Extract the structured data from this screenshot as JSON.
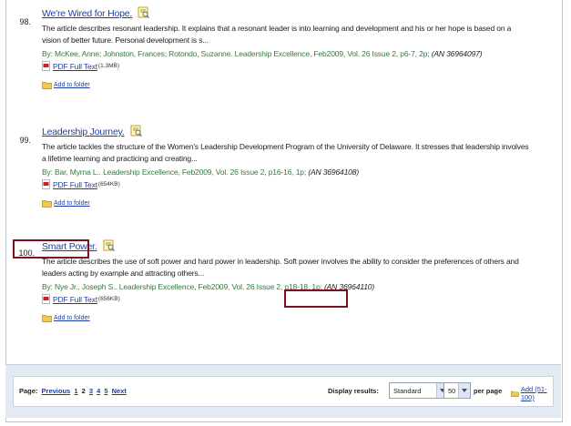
{
  "results": [
    {
      "number": "98.",
      "title": "We're Wired for Hope.",
      "abstract": "The article describes resonant leadership. It explains that a resonant leader is into learning and development and his or her hope is based on a vision of better future. Personal development is s...",
      "source": "By: McKee, Anne; Johnston, Frances; Rotondo, Suzanne. Leadership Excellence, Feb2009, Vol. 26 Issue 2, p6-7, 2p;",
      "an": "(AN 36964097)",
      "pdf_label": "PDF Full Text",
      "pdf_size": "(1.3MB)",
      "folder_label": "Add to folder"
    },
    {
      "number": "99.",
      "title": "Leadership Journey.",
      "abstract": "The article tackles the structure of the Women's Leadership Development Program of the University of Delaware. It stresses that leadership involves a lifetime learning and practicing and creating...",
      "source": "By: Bar, Myrna L.. Leadership Excellence, Feb2009, Vol. 26 Issue 2, p16-16, 1p;",
      "an": "(AN 36964108)",
      "pdf_label": "PDF Full Text",
      "pdf_size": "(654KB)",
      "folder_label": "Add to folder"
    },
    {
      "number": "100.",
      "title": "Smart Power.",
      "abstract": "The article describes the use of soft power and hard power in leadership. Soft power involves the ability to consider the preferences of others and leaders acting by example and attracting others...",
      "source": "By: Nye Jr., Joseph S.. Leadership Excellence, Feb2009, Vol. 26 Issue 2, p18-18, 1p;",
      "an": "(AN 36964110)",
      "pdf_label": "PDF Full Text",
      "pdf_size": "(656KB)",
      "folder_label": "Add to folder"
    }
  ],
  "pagination": {
    "label": "Page:",
    "previous": "Previous",
    "pages": [
      "1",
      "2",
      "3",
      "4",
      "5"
    ],
    "current": "2",
    "next": "Next"
  },
  "display": {
    "label": "Display results:",
    "mode": "Standard",
    "count": "50",
    "per_page": "per page",
    "add_label": "Add (51-100)"
  },
  "colors": {
    "link": "#1f3fa8",
    "source_text": "#2f7d3a",
    "highlight": "#7a1020"
  }
}
